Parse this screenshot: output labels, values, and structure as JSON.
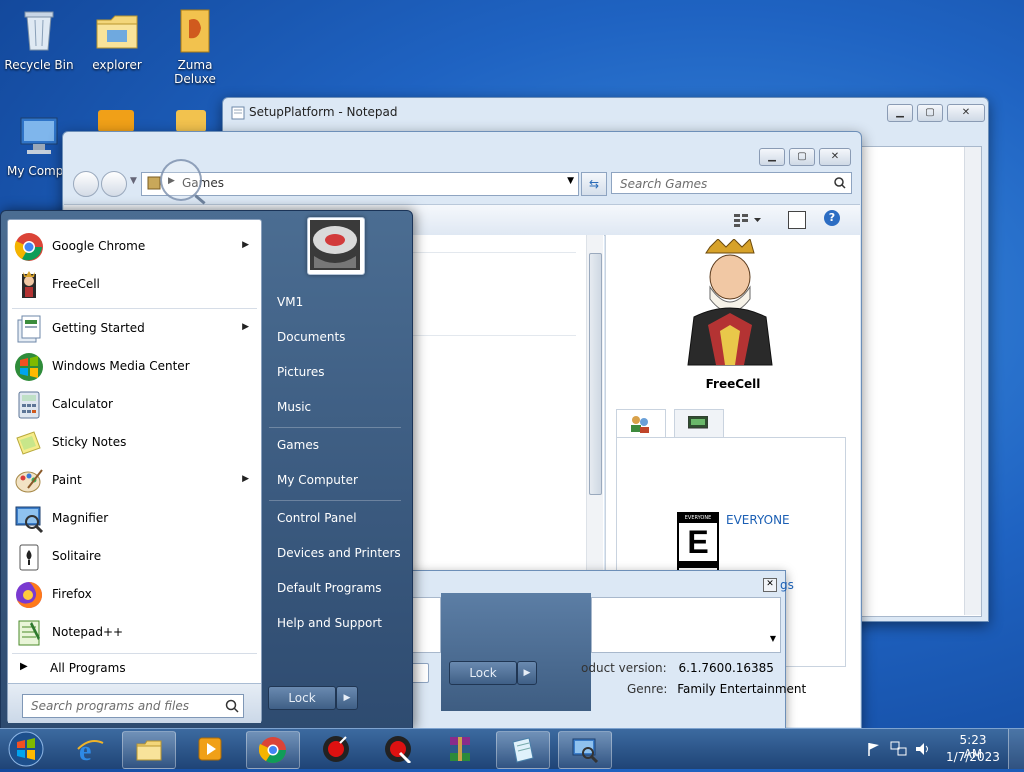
{
  "desktop": {
    "icons": [
      {
        "label": "Recycle Bin"
      },
      {
        "label": "explorer"
      },
      {
        "label": "Zuma Deluxe"
      },
      {
        "label": "My Compu"
      }
    ]
  },
  "notepad": {
    "title": "SetupPlatform - Notepad"
  },
  "explorer": {
    "breadcrumb": "Games",
    "search_placeholder": "Search Games",
    "details": {
      "game_name": "FreeCell",
      "rating": "EVERYONE",
      "product_version_label": "oduct version:",
      "product_version": "6.1.7600.16385",
      "genre_label": "Genre:",
      "genre": "Family Entertainment",
      "partial_link": "gs"
    }
  },
  "start_menu": {
    "programs": [
      {
        "label": "Google Chrome",
        "submenu": true,
        "icon": "chrome-icon"
      },
      {
        "label": "FreeCell",
        "submenu": false,
        "icon": "freecell-icon"
      },
      {
        "label": "Getting Started",
        "submenu": true,
        "icon": "getting-started-icon"
      },
      {
        "label": "Windows Media Center",
        "submenu": false,
        "icon": "media-center-icon"
      },
      {
        "label": "Calculator",
        "submenu": false,
        "icon": "calculator-icon"
      },
      {
        "label": "Sticky Notes",
        "submenu": false,
        "icon": "sticky-notes-icon"
      },
      {
        "label": "Paint",
        "submenu": true,
        "icon": "paint-icon"
      },
      {
        "label": "Magnifier",
        "submenu": false,
        "icon": "magnifier-icon"
      },
      {
        "label": "Solitaire",
        "submenu": false,
        "icon": "solitaire-icon"
      },
      {
        "label": "Firefox",
        "submenu": false,
        "icon": "firefox-icon"
      },
      {
        "label": "Notepad++",
        "submenu": false,
        "icon": "notepadpp-icon"
      }
    ],
    "all_programs": "All Programs",
    "search_placeholder": "Search programs and files",
    "right_items": [
      {
        "label": "VM1"
      },
      {
        "label": "Documents"
      },
      {
        "label": "Pictures"
      },
      {
        "label": "Music"
      },
      {
        "label": "Games"
      },
      {
        "label": "My Computer"
      },
      {
        "label": "Control Panel"
      },
      {
        "label": "Devices and Printers"
      },
      {
        "label": "Default Programs"
      },
      {
        "label": "Help and Support"
      }
    ],
    "lock_label": "Lock"
  },
  "lock_dialog": {
    "lock_label": "Lock"
  },
  "taskbar": {
    "time": "5:23 AM",
    "date": "1/7/2023"
  }
}
